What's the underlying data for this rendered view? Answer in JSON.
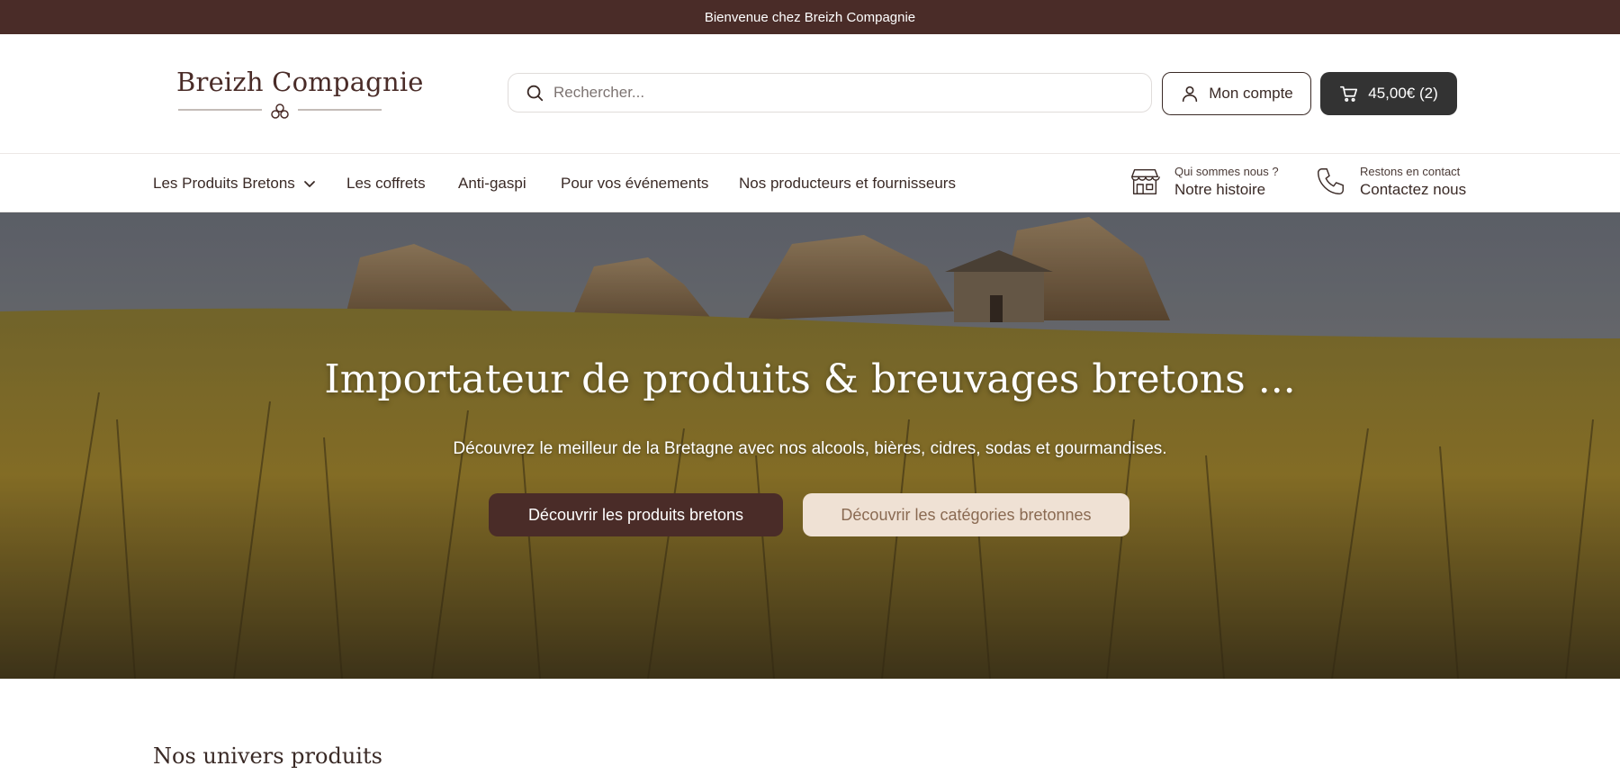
{
  "topbar": {
    "message": "Bienvenue chez Breizh Compagnie"
  },
  "header": {
    "logo_text": "Breizh Compagnie",
    "search": {
      "placeholder": "Rechercher...",
      "value": ""
    },
    "account_label": "Mon compte",
    "cart_label": "45,00€ (2)"
  },
  "nav": {
    "items": [
      {
        "label": "Les Produits Bretons",
        "has_dropdown": true
      },
      {
        "label": "Les coffrets"
      },
      {
        "label": "Anti-gaspi"
      },
      {
        "label": "Pour vos événements"
      },
      {
        "label": "Nos producteurs et fournisseurs"
      }
    ],
    "story": {
      "small": "Qui sommes nous ?",
      "big": "Notre histoire",
      "icon": "shop-icon"
    },
    "contact": {
      "small": "Restons en contact",
      "big": "Contactez nous",
      "icon": "phone-icon"
    }
  },
  "hero": {
    "title": "Importateur de produits & breuvages bretons ...",
    "subtitle": "Découvrez le meilleur de la Bretagne avec nos alcools, bières, cidres, sodas et gourmandises.",
    "primary_button": "Découvrir les produits bretons",
    "secondary_button": "Découvrir les catégories bretonnes"
  },
  "section": {
    "title": "Nos univers produits"
  },
  "colors": {
    "brand_brown": "#4a2c28",
    "cart_dark": "#333333",
    "secondary_beige": "#efe1d4",
    "secondary_text": "#8a6a52"
  }
}
